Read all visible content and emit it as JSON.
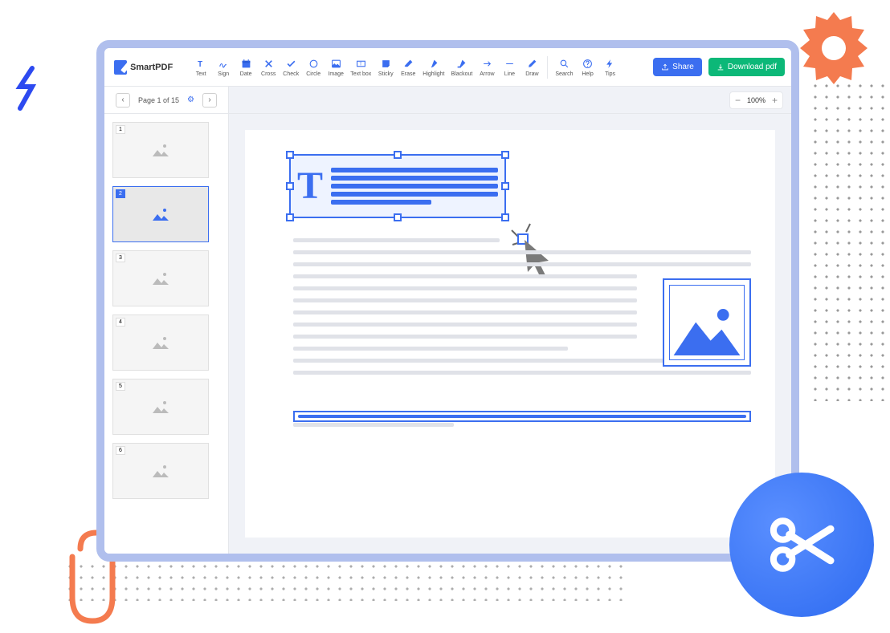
{
  "app": {
    "name": "SmartPDF"
  },
  "tools": [
    {
      "id": "text",
      "label": "Text"
    },
    {
      "id": "sign",
      "label": "Sign"
    },
    {
      "id": "date",
      "label": "Date"
    },
    {
      "id": "cross",
      "label": "Cross"
    },
    {
      "id": "check",
      "label": "Check"
    },
    {
      "id": "circle",
      "label": "Circle"
    },
    {
      "id": "image",
      "label": "Image"
    },
    {
      "id": "textbox",
      "label": "Text box"
    },
    {
      "id": "sticky",
      "label": "Sticky"
    },
    {
      "id": "erase",
      "label": "Erase"
    },
    {
      "id": "highlight",
      "label": "Highlight"
    },
    {
      "id": "blackout",
      "label": "Blackout"
    },
    {
      "id": "arrow",
      "label": "Arrow"
    },
    {
      "id": "line",
      "label": "Line"
    },
    {
      "id": "draw",
      "label": "Draw"
    }
  ],
  "help_tools": [
    {
      "id": "search",
      "label": "Search"
    },
    {
      "id": "help",
      "label": "Help"
    },
    {
      "id": "tips",
      "label": "Tips"
    }
  ],
  "buttons": {
    "share": "Share",
    "download": "Download pdf"
  },
  "page_nav": {
    "text": "Page 1 of 15"
  },
  "zoom": {
    "value": "100%"
  },
  "thumbs": {
    "count": 6,
    "active": 2
  }
}
